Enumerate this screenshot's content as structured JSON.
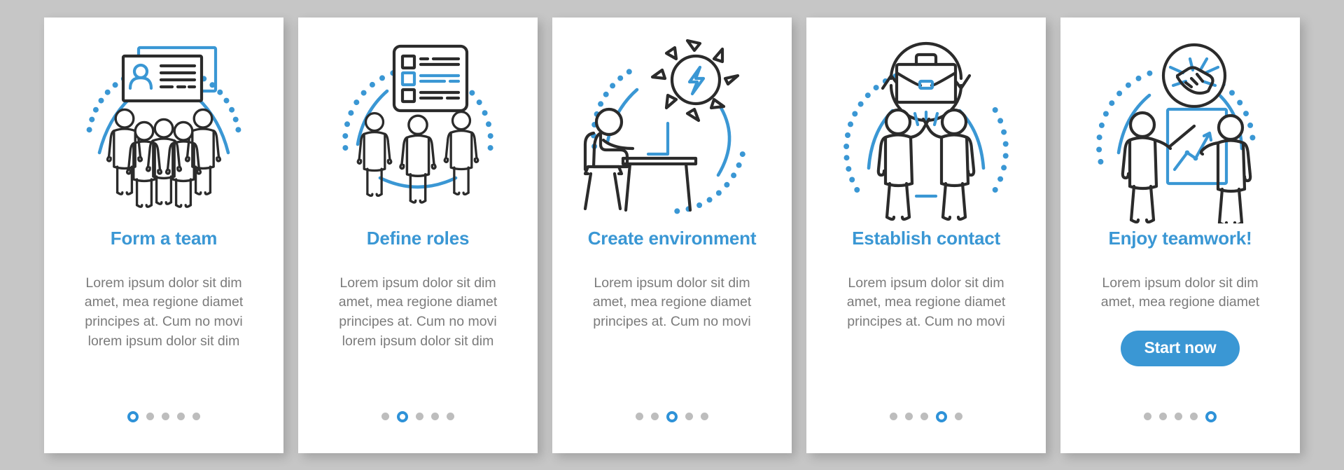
{
  "page": {
    "background_color": "#c6c6c6",
    "card_background": "#ffffff",
    "accent_color": "#3a97d4",
    "title_color": "#3a97d4",
    "body_text_color": "#7b7b7b",
    "dot_inactive_color": "#bdbdbd"
  },
  "screens": [
    {
      "id": "form-a-team",
      "illustration": "team-people-id-card-icon",
      "title": "Form a team",
      "description": "Lorem ipsum dolor sit dim amet, mea regione diamet principes at. Cum no movi lorem ipsum dolor sit dim",
      "dots": {
        "count": 5,
        "active_index": 0
      },
      "cta": null
    },
    {
      "id": "define-roles",
      "illustration": "checklist-document-three-people-icon",
      "title": "Define roles",
      "description": "Lorem ipsum dolor sit dim amet, mea regione diamet principes at. Cum no movi lorem ipsum dolor sit dim",
      "dots": {
        "count": 5,
        "active_index": 1
      },
      "cta": null
    },
    {
      "id": "create-environment",
      "illustration": "person-at-desk-sun-lightning-icon",
      "title": "Create environment",
      "description": "Lorem ipsum dolor sit dim amet, mea regione diamet principes at. Cum no movi",
      "dots": {
        "count": 5,
        "active_index": 2
      },
      "cta": null
    },
    {
      "id": "establish-contact",
      "illustration": "high-five-briefcase-cycle-icon",
      "title": "Establish contact",
      "description": "Lorem ipsum dolor sit dim amet, mea regione diamet principes at. Cum no movi",
      "dots": {
        "count": 5,
        "active_index": 3
      },
      "cta": null
    },
    {
      "id": "enjoy-teamwork",
      "illustration": "handshake-presentation-board-icon",
      "title": "Enjoy teamwork!",
      "description": "Lorem ipsum dolor sit dim amet, mea regione diamet",
      "dots": {
        "count": 5,
        "active_index": 4
      },
      "cta": {
        "label": "Start now"
      }
    }
  ]
}
